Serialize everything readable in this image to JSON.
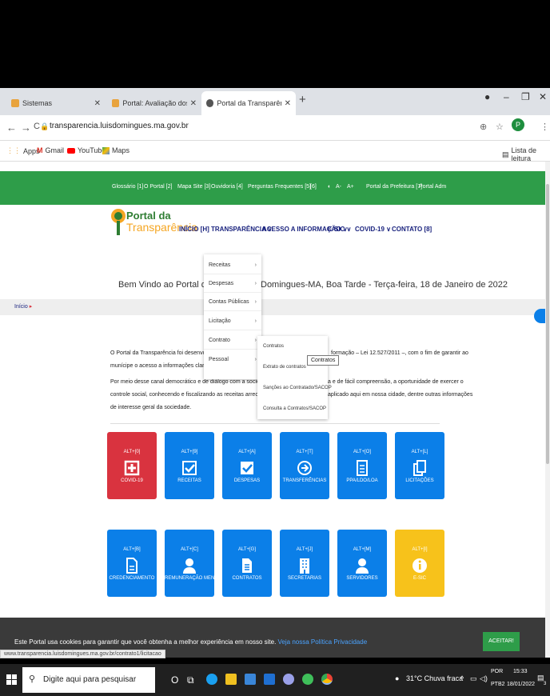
{
  "browser": {
    "tabs": [
      {
        "label": "Sistemas"
      },
      {
        "label": "Portal: Avaliação dos Portais da T"
      },
      {
        "label": "Portal da Transparência Luis Dom"
      }
    ],
    "url": "transparencia.luisdomingues.ma.gov.br",
    "bookmarks": [
      "Apps",
      "Gmail",
      "YouTube",
      "Maps"
    ],
    "reading_list": "Lista de leitura",
    "profile_initial": "P"
  },
  "topbar": {
    "items": [
      "Glossário [1]",
      "O Portal [2]",
      "Mapa Site [3]",
      "Ouvidoria [4]",
      "Perguntas Frequentes [5]",
      "[6]",
      "A-",
      "A+",
      "Portal da Prefeitura [7]",
      "Portal Adm"
    ]
  },
  "logo": {
    "line1": "Portal da",
    "line2": "Transparência"
  },
  "menu": [
    "INÍCIO [H]",
    "TRANSPARÊNCIA ∨",
    "ACESSO A INFORMAÇÃO ∨",
    "E-SIC ∨",
    "COVID-19 ∨",
    "CONTATO [8]"
  ],
  "welcome": {
    "part1": "Bem Vindo ao Portal da Prefeitu",
    "part2": "Domingues-MA, Boa Tarde - Terça-feira, 18 de Janeiro de 2022"
  },
  "breadcrumb": "Início",
  "intro": [
    "O Portal da Transparência foi desenvolvido pela P",
    "munícipe o acesso a informações claras e transpa",
    "Por meio desse canal democrático e de diálogo com a sociedade, oferece à vo",
    "controle social, conhecendo e fiscalizando as receitas arrecadadas pelo Poder",
    "de interesse geral da sociedade."
  ],
  "intro_right": [
    "formação – Lei 12.527/2011 –, com o fim de garantir ao",
    "a e de fácil compreensão, a oportunidade de exercer o",
    "aplicado aqui em nossa cidade, dentre outras informações"
  ],
  "dropdown": {
    "items": [
      "Receitas",
      "Despesas",
      "Contas Públicas",
      "Licitação",
      "Contrato",
      "Pessoal"
    ],
    "submenu": [
      "Contratos",
      "Extrato de contratos",
      "Sanções ao Contratado/SACOP",
      "Consulta a Contratos/SACOP"
    ],
    "tooltip": "Contratos"
  },
  "tiles": [
    {
      "shortcut": "ALT+[0]",
      "label": "COVID-19",
      "icon": "plus-box-icon",
      "color": "#d9333f"
    },
    {
      "shortcut": "ALT+[9]",
      "label": "RECEITAS",
      "icon": "checkbox-icon",
      "color": "#0b7fe8"
    },
    {
      "shortcut": "ALT+[A]",
      "label": "DESPESAS",
      "icon": "checkbox-icon",
      "color": "#0b7fe8"
    },
    {
      "shortcut": "ALT+[T]",
      "label": "TRANSFERÊNCIAS",
      "icon": "arrow-circle-icon",
      "color": "#0b7fe8"
    },
    {
      "shortcut": "ALT+[O]",
      "label": "PPA/LDO/LOA",
      "icon": "document-icon",
      "color": "#0b7fe8"
    },
    {
      "shortcut": "ALT+[L]",
      "label": "LICITAÇÕES",
      "icon": "copy-icon",
      "color": "#0b7fe8"
    },
    {
      "shortcut": "ALT+[B]",
      "label": "CREDENCIAMENTO",
      "icon": "file-icon",
      "color": "#0b7fe8"
    },
    {
      "shortcut": "ALT+[C]",
      "label": "REMUNERAÇÃO MENSAL",
      "icon": "user-icon",
      "color": "#0b7fe8"
    },
    {
      "shortcut": "ALT+[G]",
      "label": "CONTRATOS",
      "icon": "file-text-icon",
      "color": "#0b7fe8"
    },
    {
      "shortcut": "ALT+[J]",
      "label": "SECRETARIAS",
      "icon": "building-icon",
      "color": "#0b7fe8"
    },
    {
      "shortcut": "ALT+[M]",
      "label": "SERVIDORES",
      "icon": "user-icon",
      "color": "#0b7fe8"
    },
    {
      "shortcut": "ALT+[I]",
      "label": "E-SIC",
      "icon": "info-icon",
      "color": "#f7c21b"
    }
  ],
  "cookie": {
    "text": "Este Portal usa cookies para garantir que você obtenha a melhor experiência em nosso site.",
    "link": "Veja nossa Política Privacidade",
    "button": "ACEITAR!"
  },
  "status_url": "www.transparencia.luisdomingues.ma.gov.br/contrato1/licitacao",
  "taskbar": {
    "search_placeholder": "Digite aqui para pesquisar",
    "weather": "31°C Chuva fraca",
    "lang1": "POR",
    "lang2": "PTB2",
    "time": "15:33",
    "date": "18/01/2022",
    "notif_count": "3"
  }
}
